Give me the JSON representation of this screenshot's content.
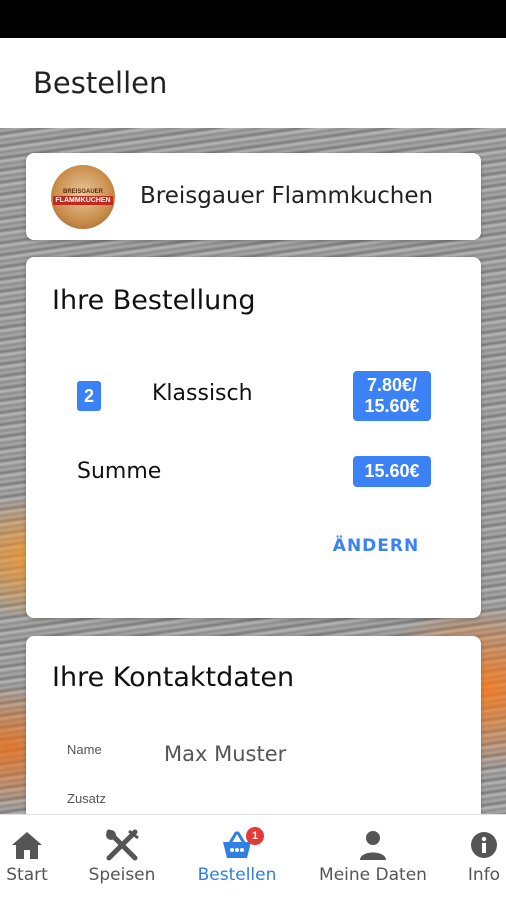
{
  "app_bar": {
    "title": "Bestellen"
  },
  "restaurant": {
    "name": "Breisgauer Flammkuchen",
    "logo_line1": "BREISGAUER",
    "logo_line2": "FLAMMKUCHEN"
  },
  "order": {
    "title": "Ihre Bestellung",
    "items": [
      {
        "quantity": "2",
        "name": "Klassisch",
        "unit_price": "7.80€/",
        "total_price": "15.60€"
      }
    ],
    "sum_label": "Summe",
    "sum_value": "15.60€",
    "change_label": "ÄNDERN"
  },
  "contact": {
    "title": "Ihre Kontaktdaten",
    "fields": [
      {
        "label": "Name",
        "value": "Max Muster"
      },
      {
        "label": "Zusatz",
        "value": ""
      }
    ]
  },
  "bottom_nav": {
    "items": [
      {
        "label": "Start",
        "icon": "home-icon"
      },
      {
        "label": "Speisen",
        "icon": "cutlery-icon"
      },
      {
        "label": "Bestellen",
        "icon": "basket-icon",
        "badge": "1",
        "active": true
      },
      {
        "label": "Meine Daten",
        "icon": "person-icon"
      },
      {
        "label": "Info",
        "icon": "info-icon"
      }
    ]
  },
  "colors": {
    "accent": "#3b82f6",
    "active_nav": "#2f7fe5",
    "badge": "#e53935"
  }
}
